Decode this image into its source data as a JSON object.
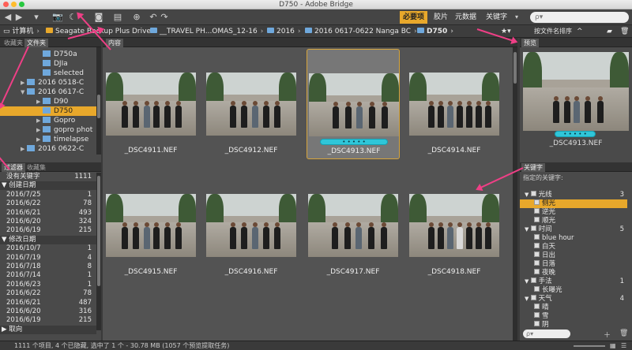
{
  "window": {
    "title": "D750 - Adobe Bridge"
  },
  "toolbar": {
    "workspaces": [
      "必要项",
      "胶片",
      "元数据",
      "关键字"
    ],
    "search_placeholder": "ρ▾"
  },
  "path": [
    {
      "label": "计算机",
      "icon": "computer-icon"
    },
    {
      "label": "Seagate Backup Plus Drive",
      "icon": "drive-icon"
    },
    {
      "label": "__TRAVEL PH...OMAS_12-16",
      "icon": "folder-icon"
    },
    {
      "label": "2016",
      "icon": "folder-icon"
    },
    {
      "label": "2016 0617-0622 Nanga BC",
      "icon": "folder-icon"
    },
    {
      "label": "D750",
      "icon": "folder-icon"
    }
  ],
  "path_right": {
    "sort_label": "按文件名排序"
  },
  "left_panel": {
    "tabs": [
      "收藏夹",
      "文件夹"
    ],
    "tree": [
      {
        "label": "D750a",
        "indent": 4,
        "twisty": ""
      },
      {
        "label": "DJIa",
        "indent": 4,
        "twisty": ""
      },
      {
        "label": "selected",
        "indent": 4,
        "twisty": ""
      },
      {
        "label": "2016 0518-C",
        "indent": 2,
        "twisty": "▶"
      },
      {
        "label": "2016 0617-C",
        "indent": 2,
        "twisty": "▼"
      },
      {
        "label": "D90",
        "indent": 4,
        "twisty": "▶"
      },
      {
        "label": "D750",
        "indent": 4,
        "twisty": "",
        "selected": true
      },
      {
        "label": "Gopro",
        "indent": 4,
        "twisty": "▶"
      },
      {
        "label": "gopro phot",
        "indent": 4,
        "twisty": "▶"
      },
      {
        "label": "timelapse",
        "indent": 4,
        "twisty": "▶"
      },
      {
        "label": "2016 0622-C",
        "indent": 2,
        "twisty": "▶"
      }
    ],
    "filter_tabs": [
      "过滤器",
      "收藏集"
    ],
    "filter_rows": [
      {
        "type": "row",
        "label": "没有关键字",
        "count": "1111"
      },
      {
        "type": "hdr",
        "label": "▼ 创建日期"
      },
      {
        "type": "row",
        "label": "2016/7/25",
        "count": "1"
      },
      {
        "type": "row",
        "label": "2016/6/22",
        "count": "78"
      },
      {
        "type": "row",
        "label": "2016/6/21",
        "count": "493"
      },
      {
        "type": "row",
        "label": "2016/6/20",
        "count": "324"
      },
      {
        "type": "row",
        "label": "2016/6/19",
        "count": "215"
      },
      {
        "type": "hdr",
        "label": "▼ 修改日期"
      },
      {
        "type": "row",
        "label": "2016/10/7",
        "count": "1"
      },
      {
        "type": "row",
        "label": "2016/7/19",
        "count": "4"
      },
      {
        "type": "row",
        "label": "2016/7/18",
        "count": "8"
      },
      {
        "type": "row",
        "label": "2016/7/14",
        "count": "1"
      },
      {
        "type": "row",
        "label": "2016/6/23",
        "count": "1"
      },
      {
        "type": "row",
        "label": "2016/6/22",
        "count": "78"
      },
      {
        "type": "row",
        "label": "2016/6/21",
        "count": "487"
      },
      {
        "type": "row",
        "label": "2016/6/20",
        "count": "316"
      },
      {
        "type": "row",
        "label": "2016/6/19",
        "count": "215"
      },
      {
        "type": "hdr",
        "label": "▶ 取向"
      }
    ]
  },
  "content": {
    "tab": "内容",
    "thumbnails": [
      {
        "file": "_DSC4911.NEF",
        "selected": false
      },
      {
        "file": "_DSC4912.NEF",
        "selected": false
      },
      {
        "file": "_DSC4913.NEF",
        "selected": true,
        "rating": "• • • • •"
      },
      {
        "file": "_DSC4914.NEF",
        "selected": false
      },
      {
        "file": "_DSC4915.NEF",
        "selected": false
      },
      {
        "file": "_DSC4916.NEF",
        "selected": false
      },
      {
        "file": "_DSC4917.NEF",
        "selected": false
      },
      {
        "file": "_DSC4918.NEF",
        "selected": false
      }
    ]
  },
  "right_panel": {
    "preview_tab": "预览",
    "preview_file": "_DSC4913.NEF",
    "keywords_tab": "关键字",
    "keywords_title": "指定的关键字:",
    "keywords": [
      {
        "label": "光线",
        "level": 0,
        "count": "3",
        "group": true
      },
      {
        "label": "侧光",
        "level": 1,
        "highlight": true
      },
      {
        "label": "逆光",
        "level": 1
      },
      {
        "label": "顺光",
        "level": 1
      },
      {
        "label": "时间",
        "level": 0,
        "count": "5",
        "group": true
      },
      {
        "label": "blue hour",
        "level": 1
      },
      {
        "label": "白天",
        "level": 1
      },
      {
        "label": "日出",
        "level": 1
      },
      {
        "label": "日落",
        "level": 1
      },
      {
        "label": "夜晚",
        "level": 1
      },
      {
        "label": "手法",
        "level": 0,
        "count": "1",
        "group": true
      },
      {
        "label": "长曝光",
        "level": 1
      },
      {
        "label": "天气",
        "level": 0,
        "count": "4",
        "group": true
      },
      {
        "label": "晴",
        "level": 1
      },
      {
        "label": "雪",
        "level": 1
      },
      {
        "label": "阴",
        "level": 1
      }
    ]
  },
  "status": {
    "text": "1111 个项目, 4 个已隐藏, 选中了 1 个 - 30.78 MB (1057 个预览提取任务)"
  },
  "colors": {
    "accent": "#e8a82b",
    "rating": "#2fc6d9",
    "annotation": "#ef3f86",
    "folder": "#6fa8dc"
  }
}
